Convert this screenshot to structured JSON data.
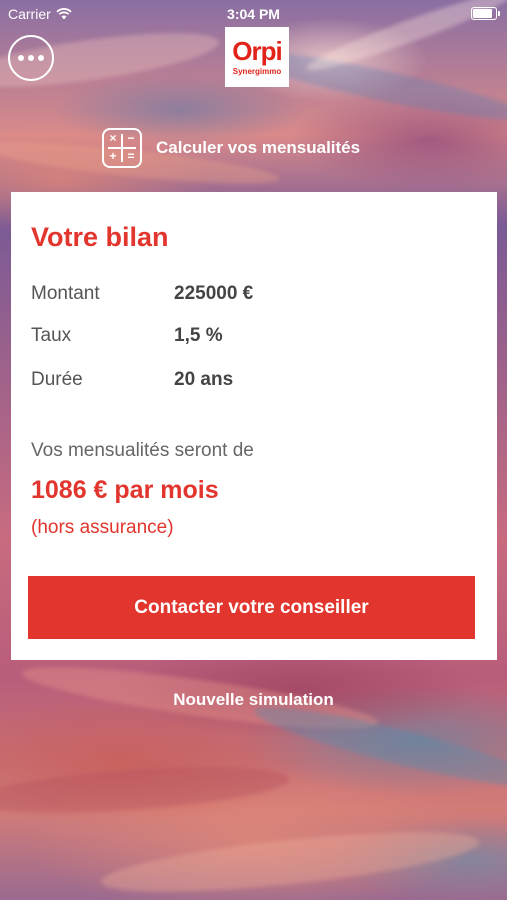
{
  "status_bar": {
    "carrier": "Carrier",
    "time": "3:04 PM",
    "wifi_icon": "wifi-icon",
    "battery_icon": "battery-icon"
  },
  "header": {
    "menu_icon": "more-horizontal-icon",
    "logo_brand": "Orpi",
    "logo_sub": "Synergimmo"
  },
  "calculator": {
    "icon": "calculator-icon",
    "symbols": [
      "×",
      "−",
      "+",
      "="
    ],
    "title": "Calculer vos mensualités"
  },
  "card": {
    "title": "Votre bilan",
    "rows": [
      {
        "label": "Montant",
        "value": "225000 €"
      },
      {
        "label": "Taux",
        "value": "1,5 %"
      },
      {
        "label": "Durée",
        "value": "20 ans"
      }
    ],
    "intro": "Vos mensualités seront de",
    "amount": "1086 € par mois",
    "note": "(hors assurance)",
    "cta_label": "Contacter votre conseiller"
  },
  "new_simulation_label": "Nouvelle simulation",
  "colors": {
    "accent": "#e2352d",
    "text": "#555555",
    "card_bg": "#ffffff"
  }
}
